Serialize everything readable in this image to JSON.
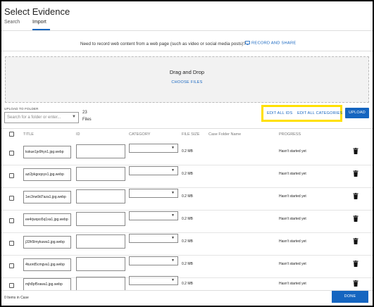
{
  "dialog": {
    "title": "Select Evidence"
  },
  "tabs": [
    {
      "label": "Search"
    },
    {
      "label": "Import"
    }
  ],
  "record": {
    "prompt": "Need to record web content from a web page (such as video or social media posts)?",
    "action_label": "RECORD AND SHARE"
  },
  "dropzone": {
    "title": "Drag and Drop",
    "action_label": "CHOOSE FILES"
  },
  "folder": {
    "label": "UPLOAD TO FOLDER",
    "placeholder": "Search for a folder or enter..."
  },
  "file_count": {
    "number": "23",
    "unit": "Files"
  },
  "toolbar": {
    "edit_ids": "EDIT ALL IDS",
    "edit_categories": "EDIT ALL CATEGORIES",
    "upload": "UPLOAD"
  },
  "table": {
    "headers": {
      "title": "TITLE",
      "id": "ID",
      "category": "CATEGORY",
      "size": "FILE SIZE",
      "folder": "Case Folder Name",
      "progress": "PROGRESS"
    },
    "rows": [
      {
        "title": "kskue1je9hyx1.jpg.webp",
        "size": "0.2 MB",
        "progress": "Hasn't started yet"
      },
      {
        "title": "azi2pkgoqoyx1.jpg.webp",
        "size": "0.2 MB",
        "progress": "Hasn't started yet"
      },
      {
        "title": "1ec3nw9d7aza1.jpg.webp",
        "size": "0.2 MB",
        "progress": "Hasn't started yet"
      },
      {
        "title": "ee4rjwqxo5q1xa1.jpg.webp",
        "size": "0.2 MB",
        "progress": "Hasn't started yet"
      },
      {
        "title": "j33h5lmykuwa1.jpg.webp",
        "size": "0.2 MB",
        "progress": "Hasn't started yet"
      },
      {
        "title": "4tuord5cmgva1.jpg.webp",
        "size": "0.2 MB",
        "progress": "Hasn't started yet"
      },
      {
        "title": "mjh8pf5rawa1.jpg.webp",
        "size": "0.2 MB",
        "progress": "Hasn't started yet"
      }
    ]
  },
  "footer": {
    "items_text": "0 Items in Case",
    "done": "DONE"
  },
  "colors": {
    "accent": "#1565c0",
    "highlight": "#ffe000"
  },
  "icons": {
    "record": "record-screen-icon",
    "delete": "trash-icon",
    "dropdown": "caret-down-icon"
  }
}
